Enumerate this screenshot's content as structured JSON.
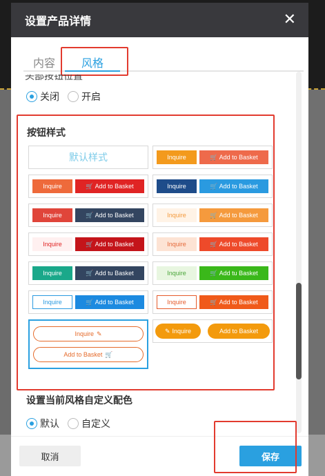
{
  "modal": {
    "title": "设置产品详情",
    "close_icon": "close-icon"
  },
  "tabs": [
    {
      "label": "内容"
    },
    {
      "label": "风格"
    }
  ],
  "cut_label": "头部按钮位置",
  "toggle": {
    "options": [
      "关闭",
      "开启"
    ],
    "selected": "关闭"
  },
  "button_style": {
    "title": "按钮样式",
    "default_label": "默认样式",
    "cells": [
      {
        "inquire": "Inquire",
        "add": "Add to Basket",
        "inq_bg": "#f39a1d",
        "inq_fg": "#ffffff",
        "add_bg": "#ee6a4b",
        "add_fg": "#ffffff"
      },
      {
        "inquire": "Inquire",
        "add": "Add to Basket",
        "inq_bg": "#ee6a3b",
        "inq_fg": "#ffffff",
        "add_bg": "#e02424",
        "add_fg": "#ffffff"
      },
      {
        "inquire": "Inquire",
        "add": "Add to Basket",
        "inq_bg": "#1e4c8a",
        "inq_fg": "#ffffff",
        "add_bg": "#2a9ae0",
        "add_fg": "#ffffff"
      },
      {
        "inquire": "Inquire",
        "add": "Add to Basket",
        "inq_bg": "#e0453a",
        "inq_fg": "#ffffff",
        "add_bg": "#334560",
        "add_fg": "#ffffff"
      },
      {
        "inquire": "Inquire",
        "add": "Add to Basket",
        "inq_bg": "#fff3e6",
        "inq_fg": "#f39a3d",
        "add_bg": "#f59a3d",
        "add_fg": "#ffffff"
      },
      {
        "inquire": "Inquire",
        "add": "Add to Basket",
        "inq_bg": "#fff0f0",
        "inq_fg": "#e02424",
        "add_bg": "#c4141a",
        "add_fg": "#ffffff"
      },
      {
        "inquire": "Inquire",
        "add": "Add to Basket",
        "inq_bg": "#fde3d4",
        "inq_fg": "#e56a3a",
        "add_bg": "#ee4a2a",
        "add_fg": "#ffffff"
      },
      {
        "inquire": "Inquire",
        "add": "Add tu Basket",
        "inq_bg": "#1aa88a",
        "inq_fg": "#ffffff",
        "add_bg": "#334560",
        "add_fg": "#ffffff"
      },
      {
        "inquire": "Inquire",
        "add": "Add tu Basket",
        "inq_bg": "#e8f6e0",
        "inq_fg": "#4aa63a",
        "add_bg": "#3ab81a",
        "add_fg": "#ffffff"
      },
      {
        "inquire": "Inquire",
        "add": "Add to Basket",
        "inq_bg": "#ffffff",
        "inq_fg": "#2a9ae0",
        "add_bg": "#1c8ae0",
        "add_fg": "#ffffff"
      },
      {
        "inquire": "Inquire",
        "add": "Add to Basket",
        "inq_bg": "#ffffff",
        "inq_fg": "#e55a2a",
        "add_bg": "#f05a1a",
        "add_fg": "#ffffff"
      }
    ],
    "selected": {
      "inquire": "Inquire",
      "add": "Add to Basket",
      "color": "#e56a2a"
    },
    "rounded": {
      "inquire": "Inquire",
      "add": "Add to Basket",
      "bg": "#f39a0d"
    }
  },
  "custom_color": {
    "title": "设置当前风格自定义配色",
    "options": [
      "默认",
      "自定义"
    ],
    "selected": "默认"
  },
  "footer": {
    "cancel": "取消",
    "save": "保存"
  },
  "colors": {
    "accent": "#2aa0e0",
    "highlight": "#e23a2e",
    "header": "#39393d"
  }
}
